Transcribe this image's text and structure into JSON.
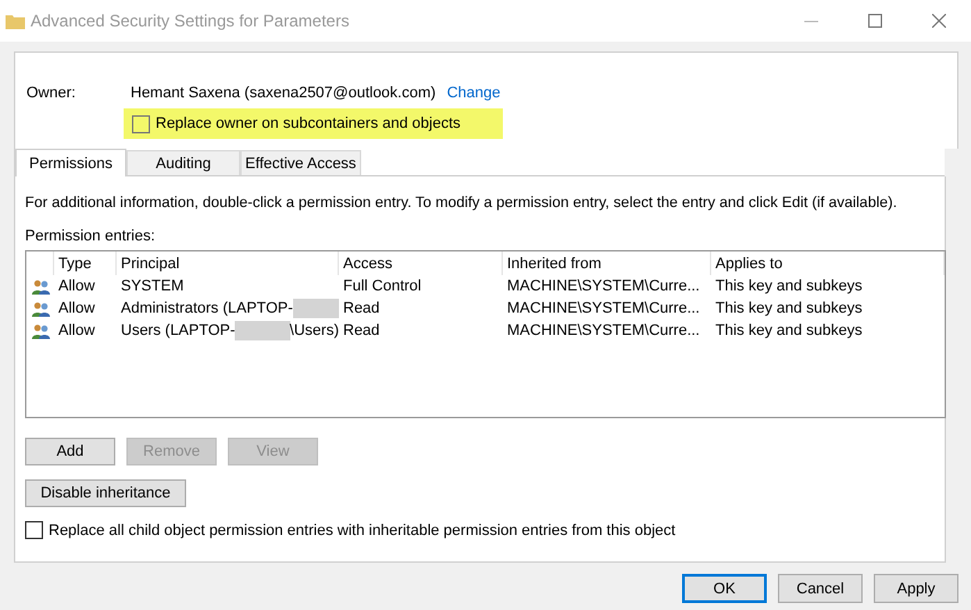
{
  "window": {
    "title": "Advanced Security Settings for Parameters"
  },
  "owner": {
    "label": "Owner:",
    "value": "Hemant Saxena (saxena2507@outlook.com)",
    "link": "Change",
    "replace_checkbox": {
      "label": "Replace owner on subcontainers and objects",
      "checked": false,
      "highlighted": true
    }
  },
  "tabs": [
    {
      "label": "Permissions",
      "selected": true
    },
    {
      "label": "Auditing",
      "selected": false
    },
    {
      "label": "Effective Access",
      "selected": false
    }
  ],
  "info": "For additional information, double-click a permission entry. To modify a permission entry, select the entry and click Edit (if available).",
  "entries_label": "Permission entries:",
  "table": {
    "columns": [
      "Type",
      "Principal",
      "Access",
      "Inherited from",
      "Applies to"
    ],
    "rows": [
      {
        "type": "Allow",
        "principal": "SYSTEM",
        "redacted": false,
        "access": "Full Control",
        "inherited_from": "MACHINE\\SYSTEM\\Curre...",
        "applies_to": "This key and subkeys"
      },
      {
        "type": "Allow",
        "principal": "Administrators (LAPTOP-",
        "redacted": true,
        "access": "Read",
        "inherited_from": "MACHINE\\SYSTEM\\Curre...",
        "applies_to": "This key and subkeys"
      },
      {
        "type": "Allow",
        "principal": "Users (LAPTOP-",
        "redacted": true,
        "principal_after": "\\Users)",
        "access": "Read",
        "inherited_from": "MACHINE\\SYSTEM\\Curre...",
        "applies_to": "This key and subkeys"
      }
    ]
  },
  "entry_buttons": [
    {
      "label": "Add",
      "disabled": false
    },
    {
      "label": "Remove",
      "disabled": true
    },
    {
      "label": "View",
      "disabled": true
    }
  ],
  "inheritance_button": {
    "label": "Disable inheritance"
  },
  "replace_child_checkbox": {
    "label": "Replace all child object permission entries with inheritable permission entries from this object",
    "checked": false
  },
  "dialog_buttons": [
    {
      "label": "OK",
      "default": true
    },
    {
      "label": "Cancel",
      "default": false
    },
    {
      "label": "Apply",
      "default": false
    }
  ]
}
